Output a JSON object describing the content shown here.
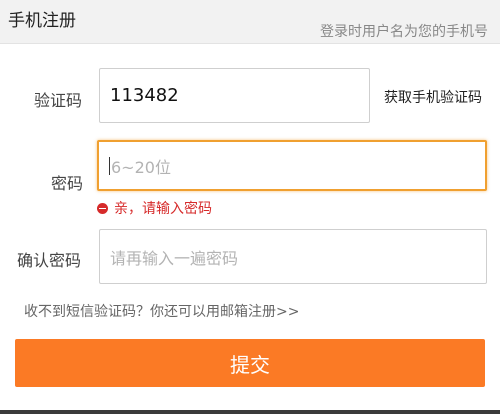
{
  "header": {
    "title": "手机注册",
    "hint": "登录时用户名为您的手机号"
  },
  "form": {
    "code": {
      "label": "验证码",
      "value": "113482",
      "get_code_label": "获取手机验证码"
    },
    "password": {
      "label": "密码",
      "placeholder": "6~20位",
      "error": "亲，请输入密码"
    },
    "confirm": {
      "label": "确认密码",
      "placeholder": "请再输入一遍密码"
    },
    "email_register_link": "收不到短信验证码？你还可以用邮箱注册>>",
    "submit_label": "提交"
  },
  "colors": {
    "accent": "#fb7a25",
    "focus_border": "#f0a030",
    "error": "#d62a2a"
  }
}
